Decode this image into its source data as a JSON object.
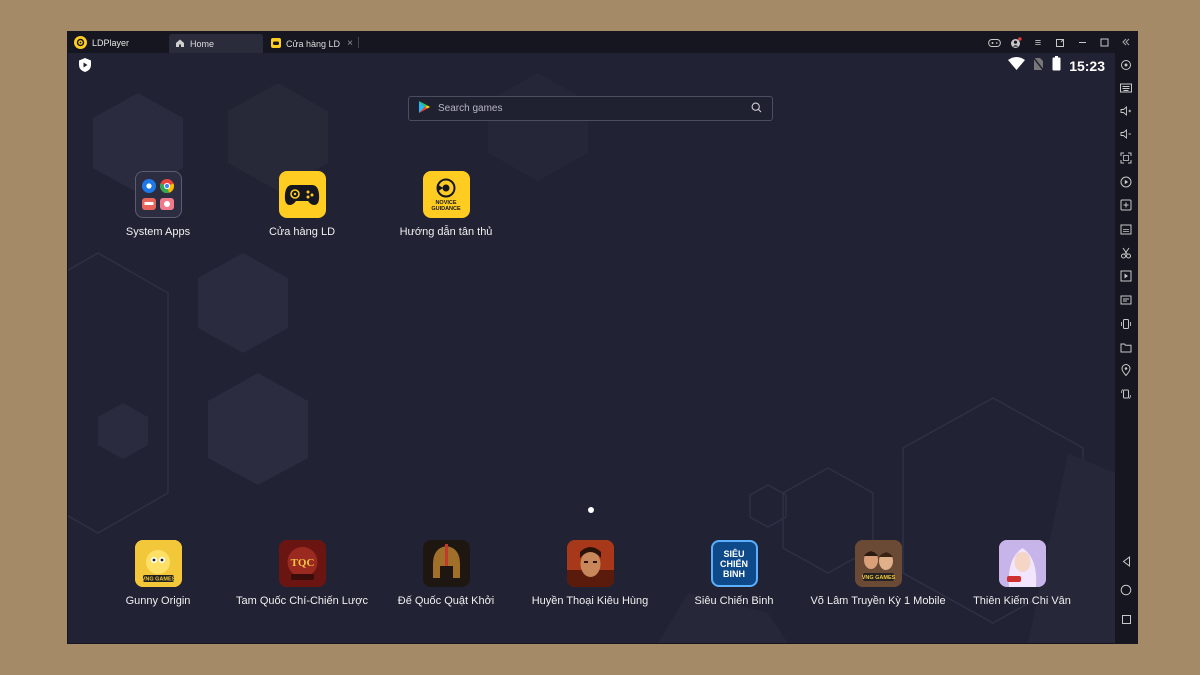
{
  "titlebar": {
    "app_name": "LDPlayer",
    "tabs": [
      {
        "label": "Home"
      },
      {
        "label": "Cửa hàng LD"
      }
    ]
  },
  "statusbar": {
    "time": "15:23"
  },
  "search": {
    "placeholder": "Search games"
  },
  "home_apps": [
    {
      "label": "System Apps",
      "icon": "folder-icon"
    },
    {
      "label": "Cửa hàng LD",
      "icon": "gamepad-icon"
    },
    {
      "label": "Hướng dẫn tân thủ",
      "icon": "novice-guidance-icon"
    }
  ],
  "home_apps_icon_text": "NOVICE GUIDANCE",
  "dock_apps": [
    {
      "label": "Gunny Origin",
      "color": "#e8b52a"
    },
    {
      "label": "Tam Quốc Chí-Chiến Lược",
      "color": "#7a1c18"
    },
    {
      "label": "Đế Quốc Quật Khởi",
      "color": "#3a2a1c"
    },
    {
      "label": "Huyền Thoại Kiêu Hùng",
      "color": "#8a2e16"
    },
    {
      "label": "Siêu Chiến Binh",
      "color": "#0e4a8a"
    },
    {
      "label": "Võ Lâm Truyền Kỳ 1 Mobile",
      "color": "#7a5238"
    },
    {
      "label": "Thiên Kiếm Chi Vân",
      "color": "#b8a2d8"
    }
  ],
  "dock_icon_text": {
    "sieu": "SIÊU CHIẾN BINH"
  },
  "colors": {
    "accent": "#ffcc22",
    "background": "#212233",
    "titlebar": "#15161f"
  }
}
